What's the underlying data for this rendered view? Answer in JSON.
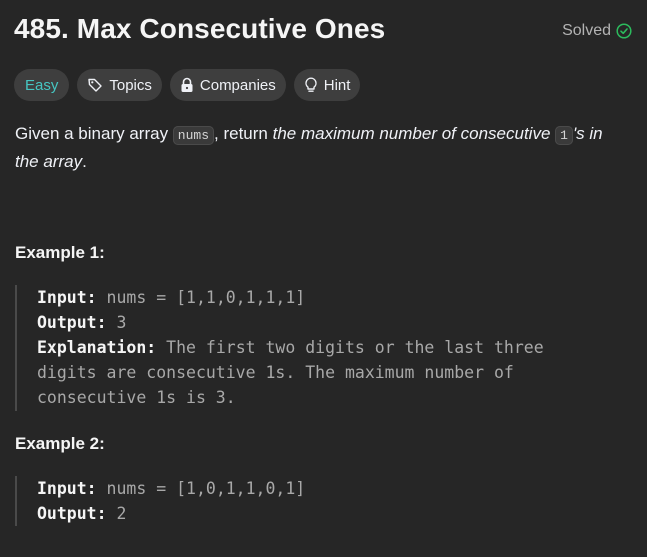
{
  "problem": {
    "title": "485. Max Consecutive Ones",
    "status": "Solved",
    "status_color": "#2cbb5d"
  },
  "tags": {
    "difficulty": "Easy",
    "topics": "Topics",
    "companies": "Companies",
    "hint": "Hint"
  },
  "description": {
    "part1": "Given a binary array ",
    "code1": "nums",
    "part2": ", return ",
    "em1": "the maximum number of consecutive ",
    "code2": "1",
    "em2": "'s in the array",
    "part3": "."
  },
  "examples": [
    {
      "title": "Example 1:",
      "input_label": "Input:",
      "input_value": " nums = [1,1,0,1,1,1]",
      "output_label": "Output:",
      "output_value": " 3",
      "explanation_label": "Explanation:",
      "explanation_line1": " The first two digits or the last three",
      "explanation_line2": "digits are consecutive 1s. The maximum number of",
      "explanation_line3": "consecutive 1s is 3."
    },
    {
      "title": "Example 2:",
      "input_label": "Input:",
      "input_value": " nums = [1,0,1,1,0,1]",
      "output_label": "Output:",
      "output_value": " 2"
    }
  ]
}
